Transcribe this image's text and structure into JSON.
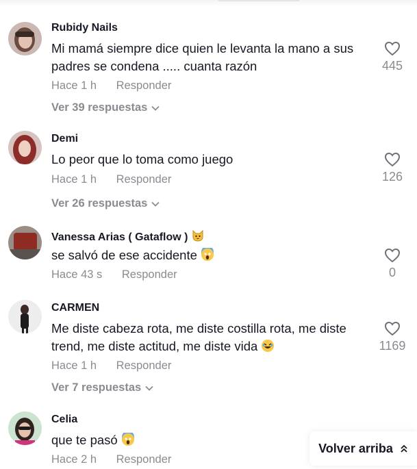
{
  "comments": [
    {
      "user": "Rubidy Nails",
      "text": "Mi mamá siempre dice quien le levanta la mano a sus padres se condena ..... cuanta razón",
      "time": "Hace 1 h",
      "reply_label": "Responder",
      "replies_label": "Ver 39 respuestas",
      "likes": "445"
    },
    {
      "user": "Demi",
      "text": "Lo peor que lo toma como juego",
      "time": "Hace 1 h",
      "reply_label": "Responder",
      "replies_label": "Ver 26 respuestas",
      "likes": "126"
    },
    {
      "user": "Vanessa Arias ( Gataflow )",
      "user_emoji": "cat-face",
      "text": "se salvó de ese accidente",
      "text_emoji": "screaming-face",
      "time": "Hace 43 s",
      "reply_label": "Responder",
      "likes": "0"
    },
    {
      "user": "CARMEN",
      "text": "Me diste cabeza rota, me diste costilla rota, me diste trend, me diste actitud, me diste vida",
      "text_emoji": "rolling-laughing-face",
      "time": "Hace 1 h",
      "reply_label": "Responder",
      "replies_label": "Ver 7 respuestas",
      "likes": "1169"
    },
    {
      "user": "Celia",
      "text": "que te pasó",
      "text_emoji": "screaming-face",
      "time": "Hace 2 h",
      "reply_label": "Responder"
    }
  ],
  "back_to_top": "Volver arriba",
  "colors": {
    "text": "#161823",
    "muted": "#8a8b91",
    "background": "#ffffff"
  }
}
